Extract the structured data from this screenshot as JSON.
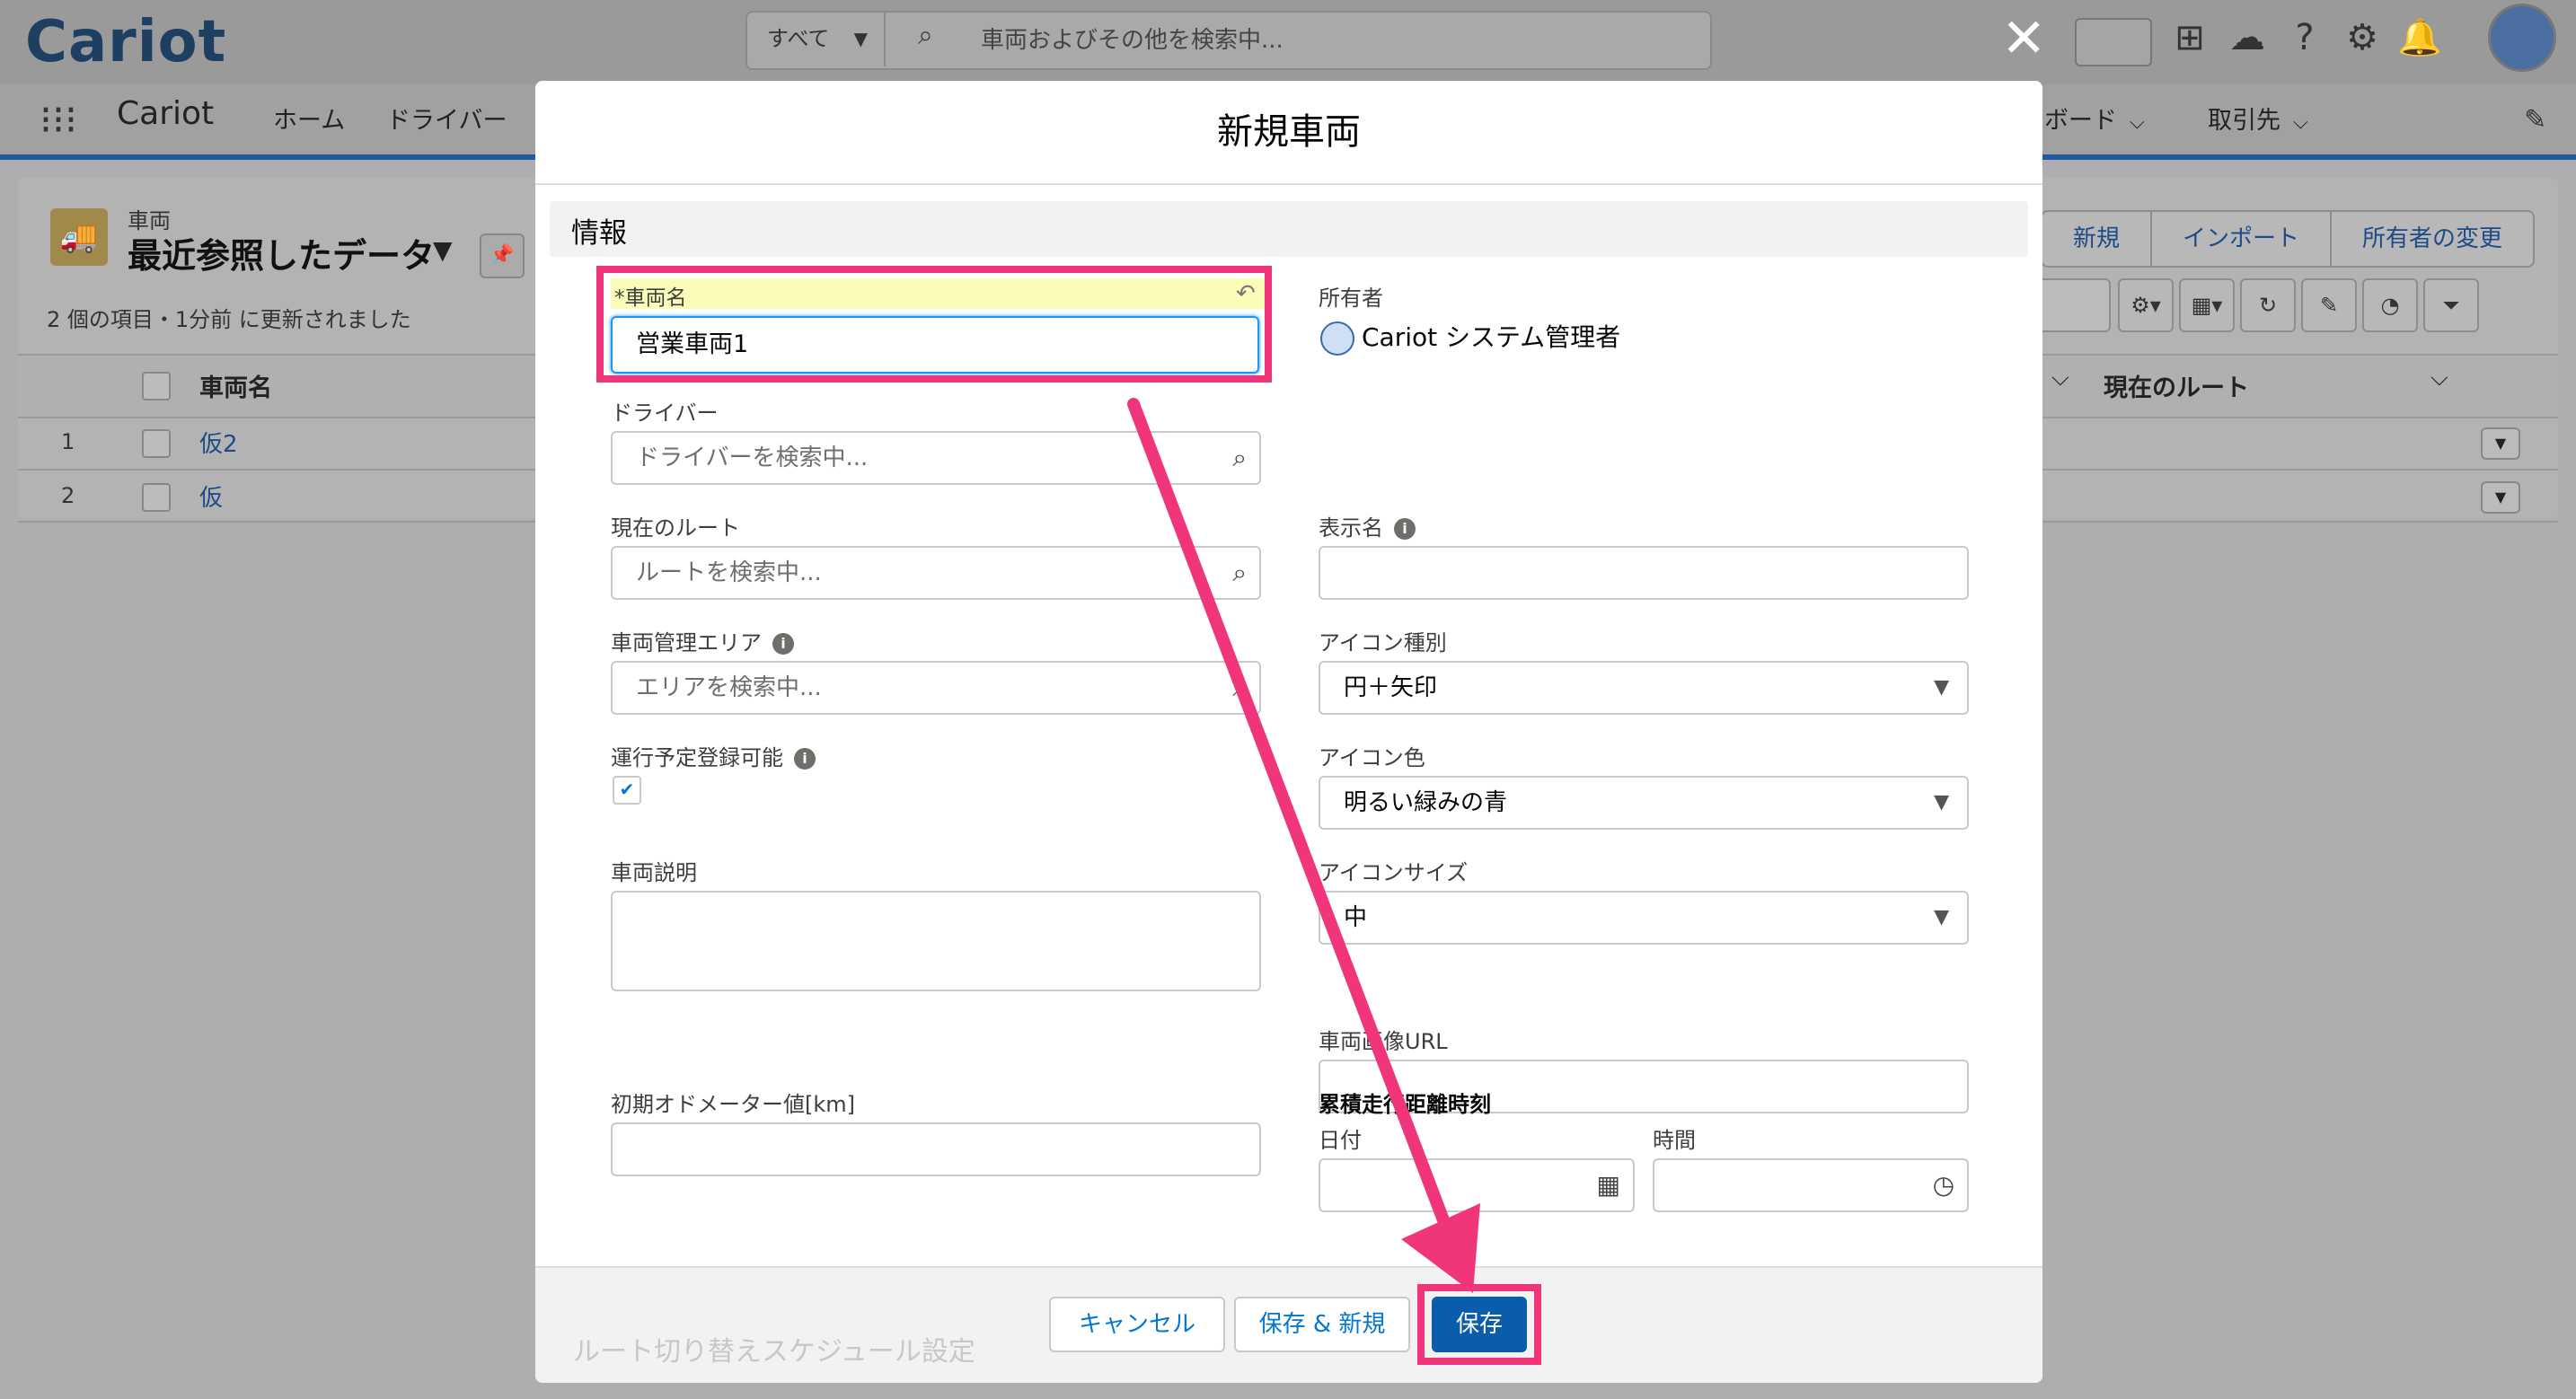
{
  "app": {
    "logo": "Cariot",
    "app_name": "Cariot",
    "search_scope": "すべて",
    "search_placeholder": "車両およびその他を検索中...",
    "nav": [
      "ホーム",
      "ドライバー",
      "ボード",
      "取引先"
    ]
  },
  "list": {
    "object_label": "車両",
    "view_title": "最近参照したデータ",
    "updated": "2 個の項目・1分前 に更新されました",
    "buttons": [
      "新規",
      "インポート",
      "所有者の変更"
    ],
    "columns": [
      "車両名",
      "現在のルート"
    ],
    "rows": [
      {
        "num": "1",
        "name": "仮2"
      },
      {
        "num": "2",
        "name": "仮"
      }
    ]
  },
  "modal": {
    "title": "新規車両",
    "section": "情報",
    "fields": {
      "vehicle_name_label": "*車両名",
      "vehicle_name_value": "営業車両1",
      "driver_label": "ドライバー",
      "driver_placeholder": "ドライバーを検索中...",
      "route_label": "現在のルート",
      "route_placeholder": "ルートを検索中...",
      "area_label": "車両管理エリア",
      "area_placeholder": "エリアを検索中...",
      "schedule_label": "運行予定登録可能",
      "schedule_checked": "✔",
      "description_label": "車両説明",
      "odometer_label": "初期オドメーター値[km]",
      "owner_label": "所有者",
      "owner_value": "Cariot システム管理者",
      "display_name_label": "表示名",
      "icon_type_label": "アイコン種別",
      "icon_type_value": "円＋矢印",
      "icon_color_label": "アイコン色",
      "icon_color_value": "明るい緑みの青",
      "icon_size_label": "アイコンサイズ",
      "icon_size_value": "中",
      "image_url_label": "車両画像URL",
      "cumulative_label": "累積走行距離時刻",
      "date_label": "日付",
      "time_label": "時間"
    },
    "footer": {
      "ghost_text": "ルート切り替えスケジュール設定",
      "cancel": "キャンセル",
      "save_new": "保存 & 新規",
      "save": "保存"
    }
  },
  "colors": {
    "highlight": "#f1357b",
    "brand": "#0b5cab"
  }
}
